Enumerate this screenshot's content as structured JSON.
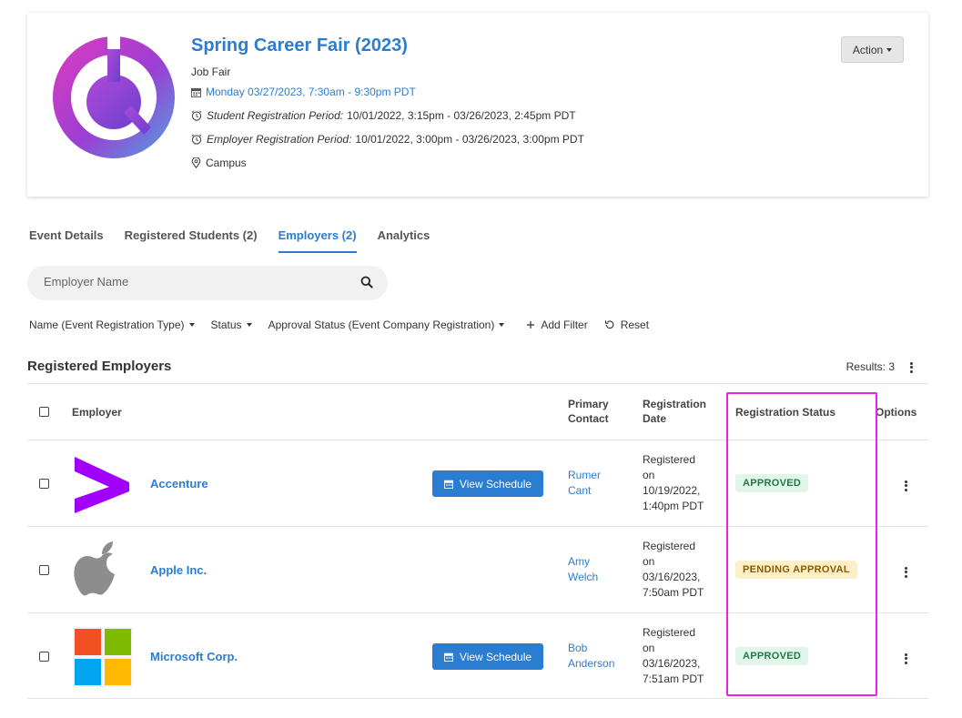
{
  "event": {
    "title": "Spring Career Fair (2023)",
    "type": "Job Fair",
    "date": "Monday 03/27/2023, 7:30am - 9:30pm PDT",
    "student_reg_label": "Student Registration Period:",
    "student_reg_value": "10/01/2022, 3:15pm - 03/26/2023, 2:45pm PDT",
    "employer_reg_label": "Employer Registration Period:",
    "employer_reg_value": "10/01/2022, 3:00pm - 03/26/2023, 3:00pm PDT",
    "location": "Campus",
    "action_label": "Action"
  },
  "tabs": [
    {
      "label": "Event Details"
    },
    {
      "label": "Registered Students (2)"
    },
    {
      "label": "Employers (2)"
    },
    {
      "label": "Analytics"
    }
  ],
  "search": {
    "placeholder": "Employer Name"
  },
  "filters": {
    "name_type": "Name (Event Registration Type)",
    "status": "Status",
    "approval": "Approval Status (Event Company Registration)",
    "add_filter": "Add Filter",
    "reset": "Reset"
  },
  "section": {
    "title": "Registered Employers",
    "results": "Results: 3"
  },
  "table": {
    "headers": {
      "employer": "Employer",
      "primary_contact_1": "Primary",
      "primary_contact_2": "Contact",
      "reg_date_1": "Registration",
      "reg_date_2": "Date",
      "reg_status": "Registration Status",
      "options": "Options"
    },
    "view_schedule": "View Schedule",
    "rows": [
      {
        "name": "Accenture",
        "contact_1": "Rumer",
        "contact_2": "Cant",
        "date_1": "Registered",
        "date_2": "on",
        "date_3": "10/19/2022,",
        "date_4": "1:40pm PDT",
        "status": "APPROVED"
      },
      {
        "name": "Apple Inc.",
        "contact_1": "Amy",
        "contact_2": "Welch",
        "date_1": "Registered",
        "date_2": "on",
        "date_3": "03/16/2023,",
        "date_4": "7:50am PDT",
        "status": "PENDING APPROVAL"
      },
      {
        "name": "Microsoft Corp.",
        "contact_1": "Bob",
        "contact_2": "Anderson",
        "date_1": "Registered",
        "date_2": "on",
        "date_3": "03/16/2023,",
        "date_4": "7:51am PDT",
        "status": "APPROVED"
      }
    ]
  },
  "colors": {
    "link": "#2a7dd1",
    "highlight": "#ee1fe6",
    "approved_bg": "#e1f5ea",
    "pending_bg": "#fdf0c8"
  }
}
